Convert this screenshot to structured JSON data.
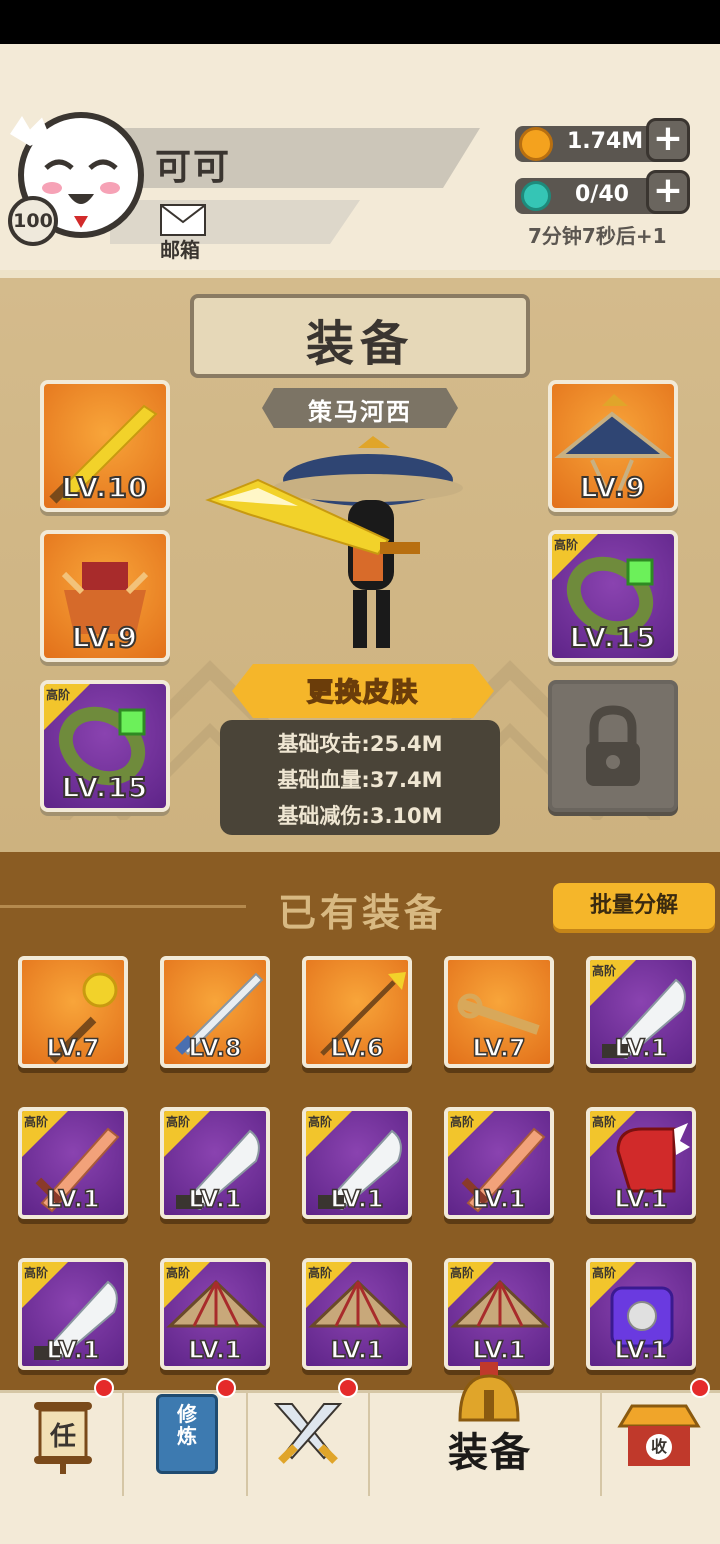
{
  "player": {
    "name": "可可",
    "level": "100",
    "mail_label": "邮箱"
  },
  "resources": {
    "coins": "1.74M",
    "energy": "0/40",
    "timer": "7分钟7秒后+1"
  },
  "equipment_panel": {
    "title": "装备",
    "skin_name": "策马河西",
    "change_skin_label": "更换皮肤",
    "stats": [
      "基础攻击:25.4M",
      "基础血量:37.4M",
      "基础减伤:3.10M"
    ],
    "slots": {
      "weapon": {
        "level": "LV.10",
        "color": "orange"
      },
      "armor": {
        "level": "LV.9",
        "color": "orange"
      },
      "ring_left": {
        "level": "LV.15",
        "color": "purple",
        "tier": "高阶"
      },
      "hat": {
        "level": "LV.9",
        "color": "orange"
      },
      "ring_right": {
        "level": "LV.15",
        "color": "purple",
        "tier": "高阶"
      },
      "locked": {
        "icon": "lock-icon"
      }
    }
  },
  "owned": {
    "title": "已有装备",
    "batch_label": "批量分解",
    "tier_label": "高阶",
    "rows": [
      [
        {
          "icon": "mace-icon",
          "level": "LV.7",
          "color": "orange"
        },
        {
          "icon": "sword-icon",
          "level": "LV.8",
          "color": "orange"
        },
        {
          "icon": "spear-icon",
          "level": "LV.6",
          "color": "orange"
        },
        {
          "icon": "key-icon",
          "level": "LV.7",
          "color": "orange"
        },
        {
          "icon": "broadsword-icon",
          "level": "LV.1",
          "color": "purple"
        }
      ],
      [
        {
          "icon": "wooden-sword-icon",
          "level": "LV.1",
          "color": "purple"
        },
        {
          "icon": "broadsword-icon",
          "level": "LV.1",
          "color": "purple"
        },
        {
          "icon": "broadsword-icon",
          "level": "LV.1",
          "color": "purple"
        },
        {
          "icon": "wooden-sword-icon",
          "level": "LV.1",
          "color": "purple"
        },
        {
          "icon": "red-gauntlet-icon",
          "level": "LV.1",
          "color": "purple"
        }
      ],
      [
        {
          "icon": "broadsword-icon",
          "level": "LV.1",
          "color": "purple"
        },
        {
          "icon": "straw-hat-icon",
          "level": "LV.1",
          "color": "purple"
        },
        {
          "icon": "straw-hat-icon",
          "level": "LV.1",
          "color": "purple"
        },
        {
          "icon": "straw-hat-icon",
          "level": "LV.1",
          "color": "purple"
        },
        {
          "icon": "orb-armor-icon",
          "level": "LV.1",
          "color": "purple"
        }
      ]
    ]
  },
  "nav": {
    "tasks_glyph": "任",
    "cultivate_glyph": "修炼",
    "collect_glyph": "收",
    "active_label": "装备"
  },
  "colors": {
    "accent": "#f5b62a",
    "panel_brown": "#8a5c23",
    "epic_purple": "#6a2b96",
    "rare_orange": "#f08a22"
  }
}
